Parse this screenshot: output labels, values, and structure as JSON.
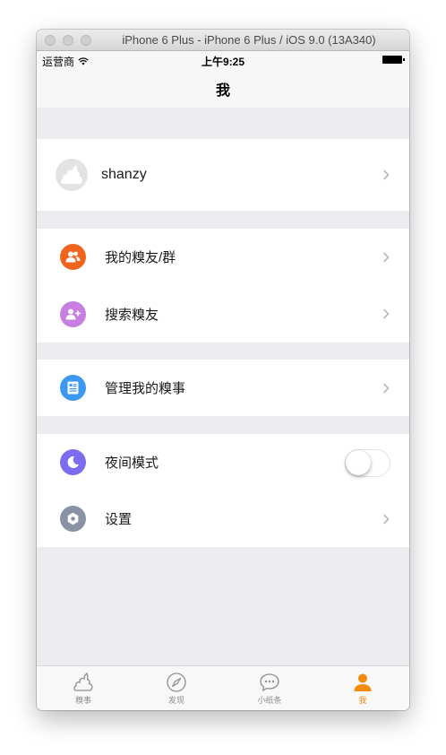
{
  "window": {
    "title": "iPhone 6 Plus - iPhone 6 Plus / iOS 9.0 (13A340)"
  },
  "status_bar": {
    "carrier": "运营商",
    "time": "上午9:25"
  },
  "nav": {
    "title": "我"
  },
  "profile": {
    "username": "shanzy"
  },
  "menu": {
    "friends": "我的糗友/群",
    "search": "搜索糗友",
    "manage": "管理我的糗事",
    "night": "夜间模式",
    "settings": "设置"
  },
  "night_mode": {
    "on": false
  },
  "tabs": [
    {
      "label": "糗事",
      "icon": "poop-icon"
    },
    {
      "label": "发现",
      "icon": "compass-icon"
    },
    {
      "label": "小纸条",
      "icon": "chat-bubble-icon"
    },
    {
      "label": "我",
      "icon": "person-icon",
      "active": true
    }
  ],
  "colors": {
    "friends_icon": "#f0641e",
    "search_icon": "#c77ee0",
    "manage_icon": "#3d98f2",
    "night_icon": "#7b6cf0",
    "settings_icon": "#8a93a6",
    "tab_active": "#f28a0c",
    "background": "#ebebf0"
  }
}
